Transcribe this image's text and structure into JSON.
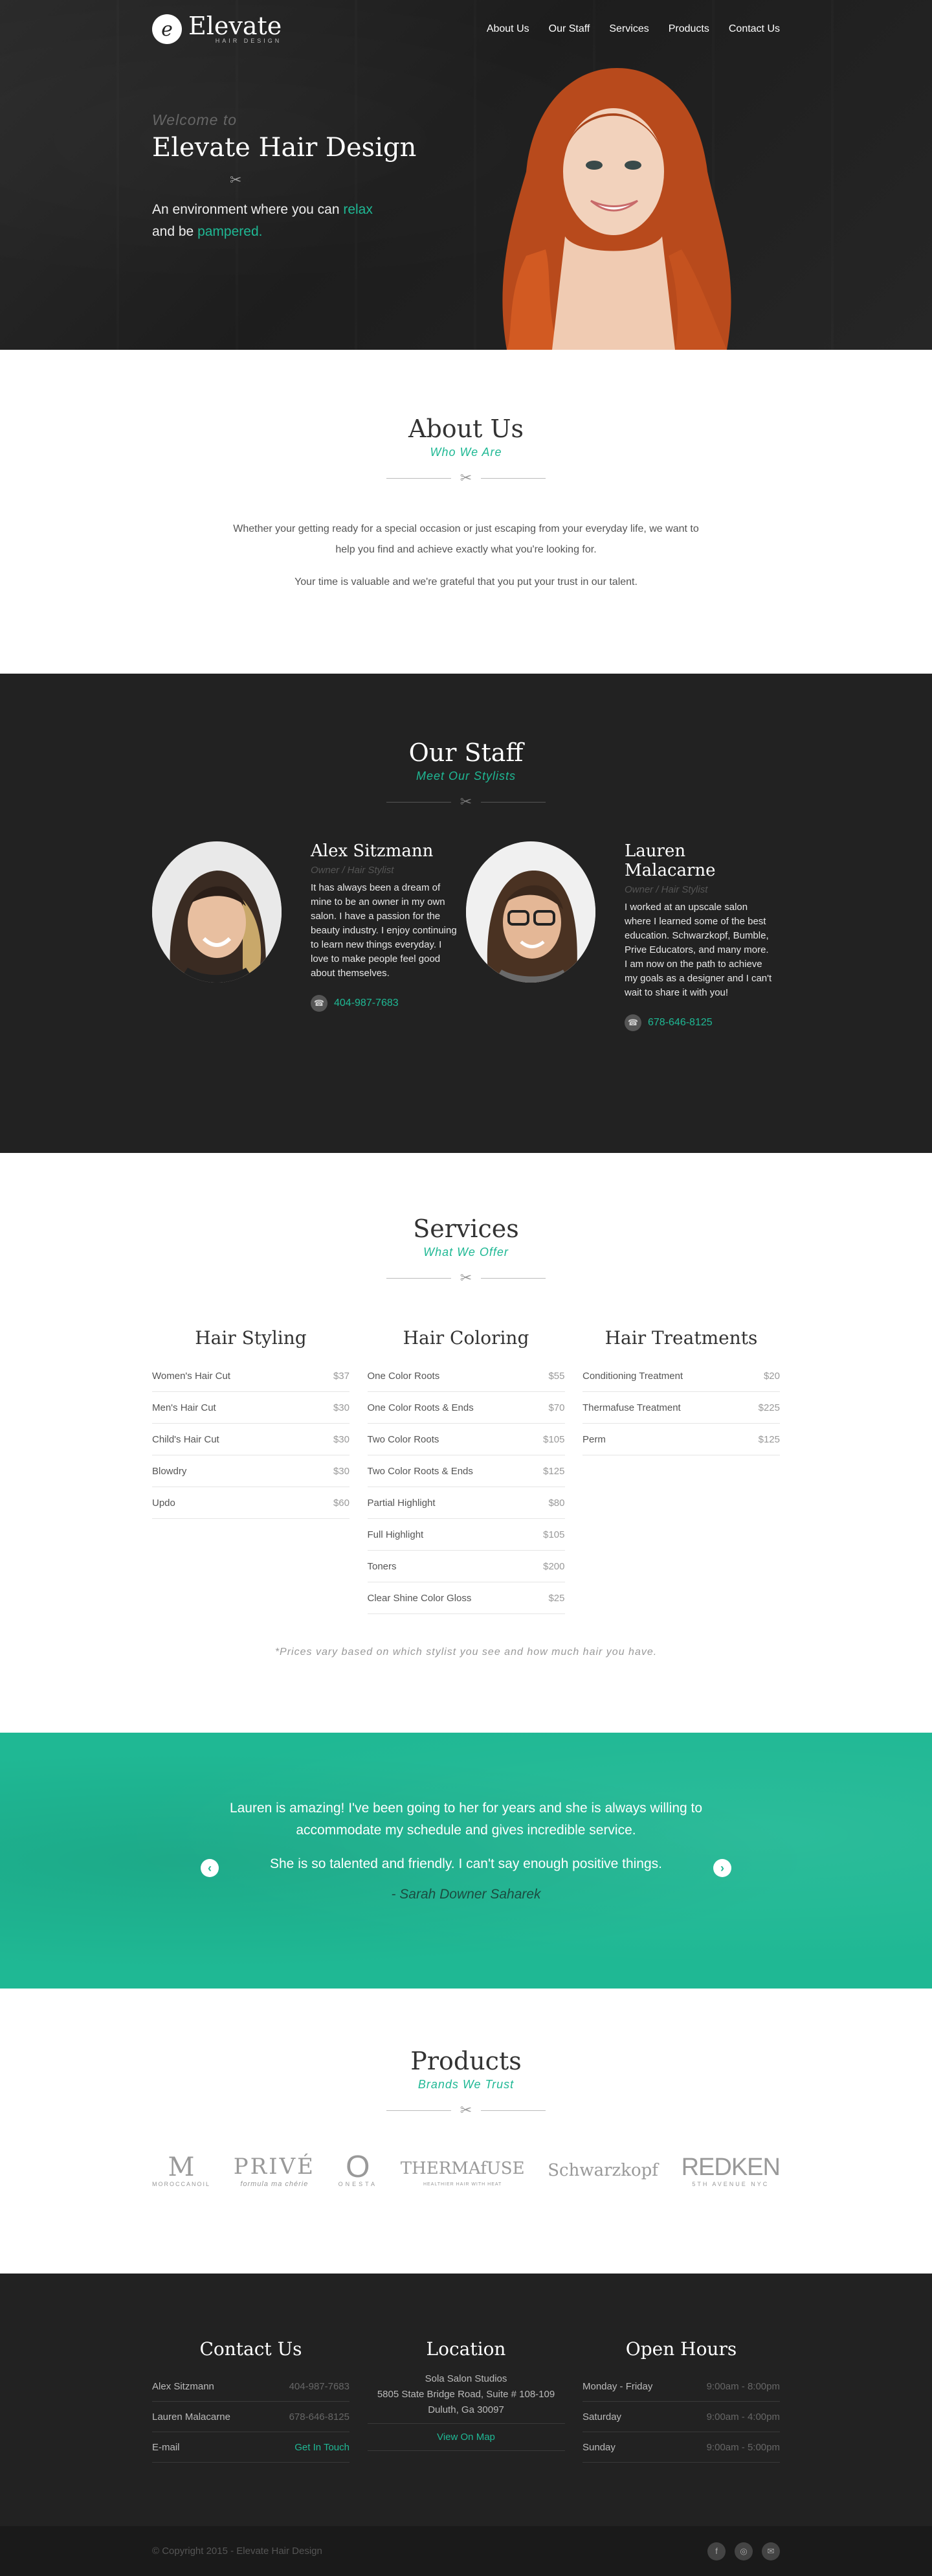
{
  "brand": {
    "name": "Elevate",
    "tagline": "HAIR DESIGN",
    "mark": "e"
  },
  "nav": [
    {
      "label": "About Us"
    },
    {
      "label": "Our Staff"
    },
    {
      "label": "Services"
    },
    {
      "label": "Products"
    },
    {
      "label": "Contact Us"
    }
  ],
  "hero": {
    "welcome": "Welcome to",
    "title": "Elevate Hair Design",
    "line1_pre": "An environment where you can ",
    "line1_accent": "relax",
    "line2_pre": "and be ",
    "line2_accent": "pampered."
  },
  "about": {
    "title": "About Us",
    "subtitle": "Who We Are",
    "p1": "Whether your getting ready for a special occasion or just escaping from your everyday life, we want to help you find and achieve exactly what you're looking for.",
    "p2": "Your time is valuable and we're grateful that you put your trust in our talent."
  },
  "staff": {
    "title": "Our Staff",
    "subtitle": "Meet Our Stylists",
    "members": [
      {
        "name": "Alex Sitzmann",
        "role": "Owner / Hair Stylist",
        "bio": "It has always been a dream of mine to be an owner in my own salon. I have a passion for the beauty industry. I enjoy continuing to learn new things everyday. I love to make people feel good about themselves.",
        "phone": "404-987-7683"
      },
      {
        "name": "Lauren Malacarne",
        "role": "Owner / Hair Stylist",
        "bio": "I worked at an upscale salon where I learned some of the best education. Schwarzkopf, Bumble, Prive Educators, and many more. I am now on the path to achieve my goals as a designer and I can't wait to share it with you!",
        "phone": "678-646-8125"
      }
    ]
  },
  "services": {
    "title": "Services",
    "subtitle": "What We Offer",
    "columns": [
      {
        "title": "Hair Styling",
        "items": [
          {
            "name": "Women's Hair Cut",
            "price": "$37"
          },
          {
            "name": "Men's Hair Cut",
            "price": "$30"
          },
          {
            "name": "Child's Hair Cut",
            "price": "$30"
          },
          {
            "name": "Blowdry",
            "price": "$30"
          },
          {
            "name": "Updo",
            "price": "$60"
          }
        ]
      },
      {
        "title": "Hair Coloring",
        "items": [
          {
            "name": "One Color Roots",
            "price": "$55"
          },
          {
            "name": "One Color Roots & Ends",
            "price": "$70"
          },
          {
            "name": "Two Color Roots",
            "price": "$105"
          },
          {
            "name": "Two Color Roots & Ends",
            "price": "$125"
          },
          {
            "name": "Partial Highlight",
            "price": "$80"
          },
          {
            "name": "Full Highlight",
            "price": "$105"
          },
          {
            "name": "Toners",
            "price": "$200"
          },
          {
            "name": "Clear Shine Color Gloss",
            "price": "$25"
          }
        ]
      },
      {
        "title": "Hair Treatments",
        "items": [
          {
            "name": "Conditioning Treatment",
            "price": "$20"
          },
          {
            "name": "Thermafuse Treatment",
            "price": "$225"
          },
          {
            "name": "Perm",
            "price": "$125"
          }
        ]
      }
    ],
    "note": "*Prices vary based on which stylist you see and how much hair you have."
  },
  "testimonial": {
    "p1": "Lauren is amazing! I've been going to her for years and she is always willing to accommodate my schedule and gives incredible service.",
    "p2": "She is so talented and friendly. I can't say enough positive things.",
    "author": "- Sarah Downer Saharek"
  },
  "products": {
    "title": "Products",
    "subtitle": "Brands We Trust",
    "brands": [
      {
        "big": "M",
        "small": "MOROCCANOIL"
      },
      {
        "big": "PRIVÉ",
        "small": "formula ma chérie"
      },
      {
        "big": "O",
        "small": "ONESTA"
      },
      {
        "big": "THERMAfUSE",
        "small": "HEALTHIER HAIR WITH HEAT"
      },
      {
        "big": "Schwarzkopf",
        "small": ""
      },
      {
        "big": "REDKEN",
        "small": "5TH AVENUE NYC"
      }
    ]
  },
  "contact": {
    "title": "Contact Us",
    "rows": [
      {
        "label": "Alex Sitzmann",
        "value": "404-987-7683"
      },
      {
        "label": "Lauren Malacarne",
        "value": "678-646-8125"
      },
      {
        "label": "E-mail",
        "value": "Get In Touch"
      }
    ]
  },
  "location": {
    "title": "Location",
    "line1": "Sola Salon Studios",
    "line2": "5805 State Bridge Road, Suite # 108-109",
    "line3": "Duluth, Ga 30097",
    "map_link": "View On Map"
  },
  "hours": {
    "title": "Open Hours",
    "rows": [
      {
        "day": "Monday - Friday",
        "time": "9:00am - 8:00pm"
      },
      {
        "day": "Saturday",
        "time": "9:00am - 4:00pm"
      },
      {
        "day": "Sunday",
        "time": "9:00am - 5:00pm"
      }
    ]
  },
  "footer": {
    "copyright": "© Copyright 2015 - Elevate Hair Design"
  },
  "colors": {
    "accent": "#1fb894",
    "dark": "#222222"
  }
}
